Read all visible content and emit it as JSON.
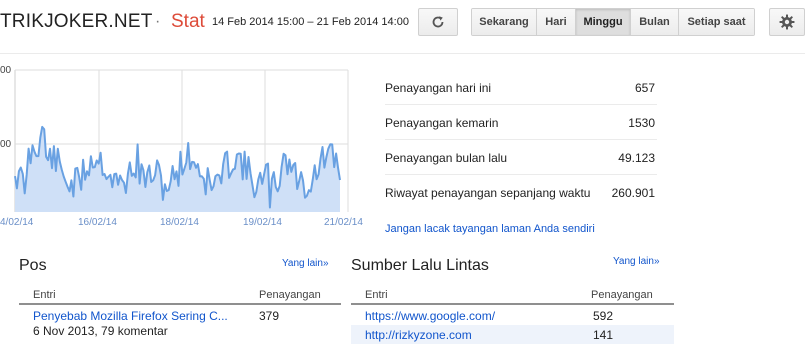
{
  "header": {
    "blog_name": "TRIKJOKER.NET",
    "separator": "·",
    "title": "Stat",
    "date_range": "14 Feb 2014 15:00 – 21 Feb 2014 14:00",
    "refresh_icon": "refresh-icon",
    "settings_icon": "gear-icon",
    "range_buttons": [
      "Sekarang",
      "Hari",
      "Minggu",
      "Bulan",
      "Setiap saat"
    ],
    "active_range": "Minggu"
  },
  "chart": {
    "y_labels": [
      "00",
      "00"
    ],
    "x_ticks": [
      "4/02/14",
      "16/02/14",
      "18/02/14",
      "19/02/14",
      "21/02/14"
    ],
    "colors": {
      "line": "#69a1e2",
      "fill": "#cfe0f7",
      "grid": "#dddddd"
    }
  },
  "summary": {
    "rows": [
      {
        "label": "Penayangan hari ini",
        "value": "657"
      },
      {
        "label": "Penayangan kemarin",
        "value": "1530"
      },
      {
        "label": "Penayangan bulan lalu",
        "value": "49.123"
      },
      {
        "label": "Riwayat penayangan sepanjang waktu",
        "value": "260.901"
      }
    ],
    "track_link": "Jangan lacak tayangan laman Anda sendiri"
  },
  "posts_panel": {
    "title": "Pos",
    "more": "Yang lain»",
    "col_entry": "Entri",
    "col_views": "Penayangan",
    "rows": [
      {
        "title": "Penyebab Mozilla Firefox Sering C...",
        "meta": "6 Nov 2013, 79 komentar",
        "views": "379"
      }
    ]
  },
  "traffic_panel": {
    "title": "Sumber Lalu Lintas",
    "more": "Yang lain»",
    "col_entry": "Entri",
    "col_views": "Penayangan",
    "rows": [
      {
        "url": "https://www.google.com/",
        "views": "592"
      },
      {
        "url": "http://rizkyzone.com",
        "views": "141"
      }
    ]
  }
}
